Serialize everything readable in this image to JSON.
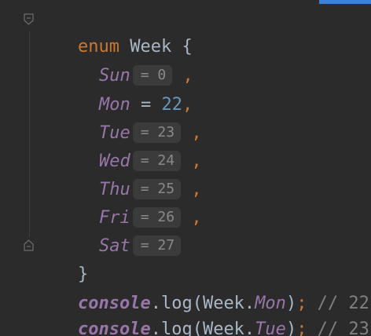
{
  "code": {
    "line1": {
      "keyword": "enum",
      "name": " Week ",
      "brace": "{"
    },
    "members": [
      {
        "name": "Sun",
        "hint": "= 0",
        "comma": " ,"
      },
      {
        "name": "Mon",
        "assign": " = ",
        "value": "22",
        "comma": ","
      },
      {
        "name": "Tue",
        "hint": "= 23",
        "comma": " ,"
      },
      {
        "name": "Wed",
        "hint": "= 24",
        "comma": " ,"
      },
      {
        "name": "Thu",
        "hint": "= 25",
        "comma": " ,"
      },
      {
        "name": "Fri",
        "hint": "= 26",
        "comma": " ,"
      },
      {
        "name": "Sat",
        "hint": "= 27"
      }
    ],
    "close_brace": "}",
    "log_lines": [
      {
        "obj": "console",
        "dot": ".",
        "method": "log",
        "open": "(Week.",
        "prop": "Mon",
        "close": ")",
        "semi": ";",
        "comment": " // 22"
      },
      {
        "obj": "console",
        "dot": ".",
        "method": "log",
        "open": "(Week.",
        "prop": "Tue",
        "close": ")",
        "semi": ";",
        "comment": " // 23"
      }
    ]
  },
  "colors": {
    "background": "#2b2b2b",
    "keyword": "#cc7832",
    "identifier": "#a9b7c6",
    "enum_member": "#9876aa",
    "number": "#6897bb",
    "comment": "#808080",
    "inlay_hint_bg": "#3b3b3b",
    "scroll_marker": "#3d7fd9"
  },
  "icons": [
    "fold-open-icon",
    "fold-close-icon"
  ]
}
